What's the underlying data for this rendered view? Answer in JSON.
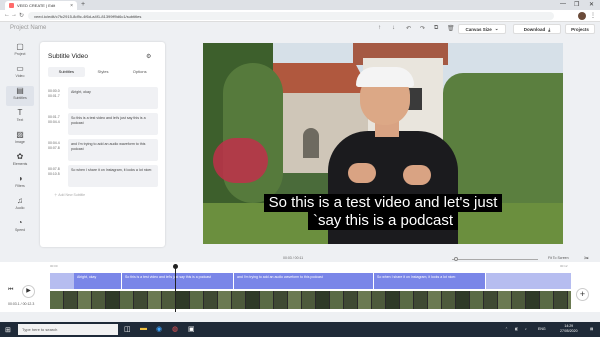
{
  "browser": {
    "tab_title": "VEED CREATE | Edit",
    "url": "veed.io/edit/c7fc2915-8d9c-4f6d-a4f1-81399ff9d6c1/subtitles",
    "win_min": "—",
    "win_max": "❐",
    "win_close": "✕"
  },
  "header": {
    "project_name": "Project Name",
    "canvas_size_label": "Canvas Size",
    "download_label": "Download",
    "projects_label": "Projects"
  },
  "rail": [
    {
      "icon": "▢",
      "label": "Project"
    },
    {
      "icon": "▭",
      "label": "Video"
    },
    {
      "icon": "▤",
      "label": "Subtitles"
    },
    {
      "icon": "T",
      "label": "Text"
    },
    {
      "icon": "▨",
      "label": "Image"
    },
    {
      "icon": "✿",
      "label": "Elements"
    },
    {
      "icon": "◑",
      "label": "Filters"
    },
    {
      "icon": "♫",
      "label": "Audio"
    },
    {
      "icon": "◔",
      "label": "Speed"
    }
  ],
  "panel": {
    "title": "Subtitle Video",
    "tabs": [
      "Subtitles",
      "Styles",
      "Options"
    ],
    "add_label": "Add New Subtitle",
    "subtitles": [
      {
        "start": "00:00.0",
        "end": "00:01.7",
        "text": "Alright, okay"
      },
      {
        "start": "00:01.7",
        "end": "00:04.4",
        "text": "So this is a test video and let's just say this is a podcast"
      },
      {
        "start": "00:04.4",
        "end": "00:07.8",
        "text": "and I'm trying to add an audio waveform to this podcast"
      },
      {
        "start": "00:07.8",
        "end": "00:10.5",
        "text": "So when I share it on Instagram, it looks a lot nicer."
      }
    ]
  },
  "video": {
    "caption_line1": "So this is a test video and let's just",
    "caption_line2": "`say this is a podcast"
  },
  "playback": {
    "time_display": "00:03 / 00:11",
    "fit_label": "Fit To Screen",
    "current_time": "00:03.1 / 00:12.3",
    "ruler_start": "00:00",
    "ruler_end": "00:12",
    "playhead_fraction": 0.26
  },
  "timeline": {
    "segments": [
      {
        "text": "Alright, okay"
      },
      {
        "text": "So this is a test video and let's just say this is a podcast"
      },
      {
        "text": "and I'm trying to add an audio waveform to this podcast"
      },
      {
        "text": "So when I share it on Instagram, it looks a lot nicer."
      }
    ]
  },
  "taskbar": {
    "search_placeholder": "Type here to search",
    "lang": "ENG",
    "time": "14:29",
    "date": "27/05/2020"
  },
  "colors": {
    "accent": "#7a86e8",
    "accent_light": "#b6bdf0",
    "taskbar": "#1f2a38"
  }
}
